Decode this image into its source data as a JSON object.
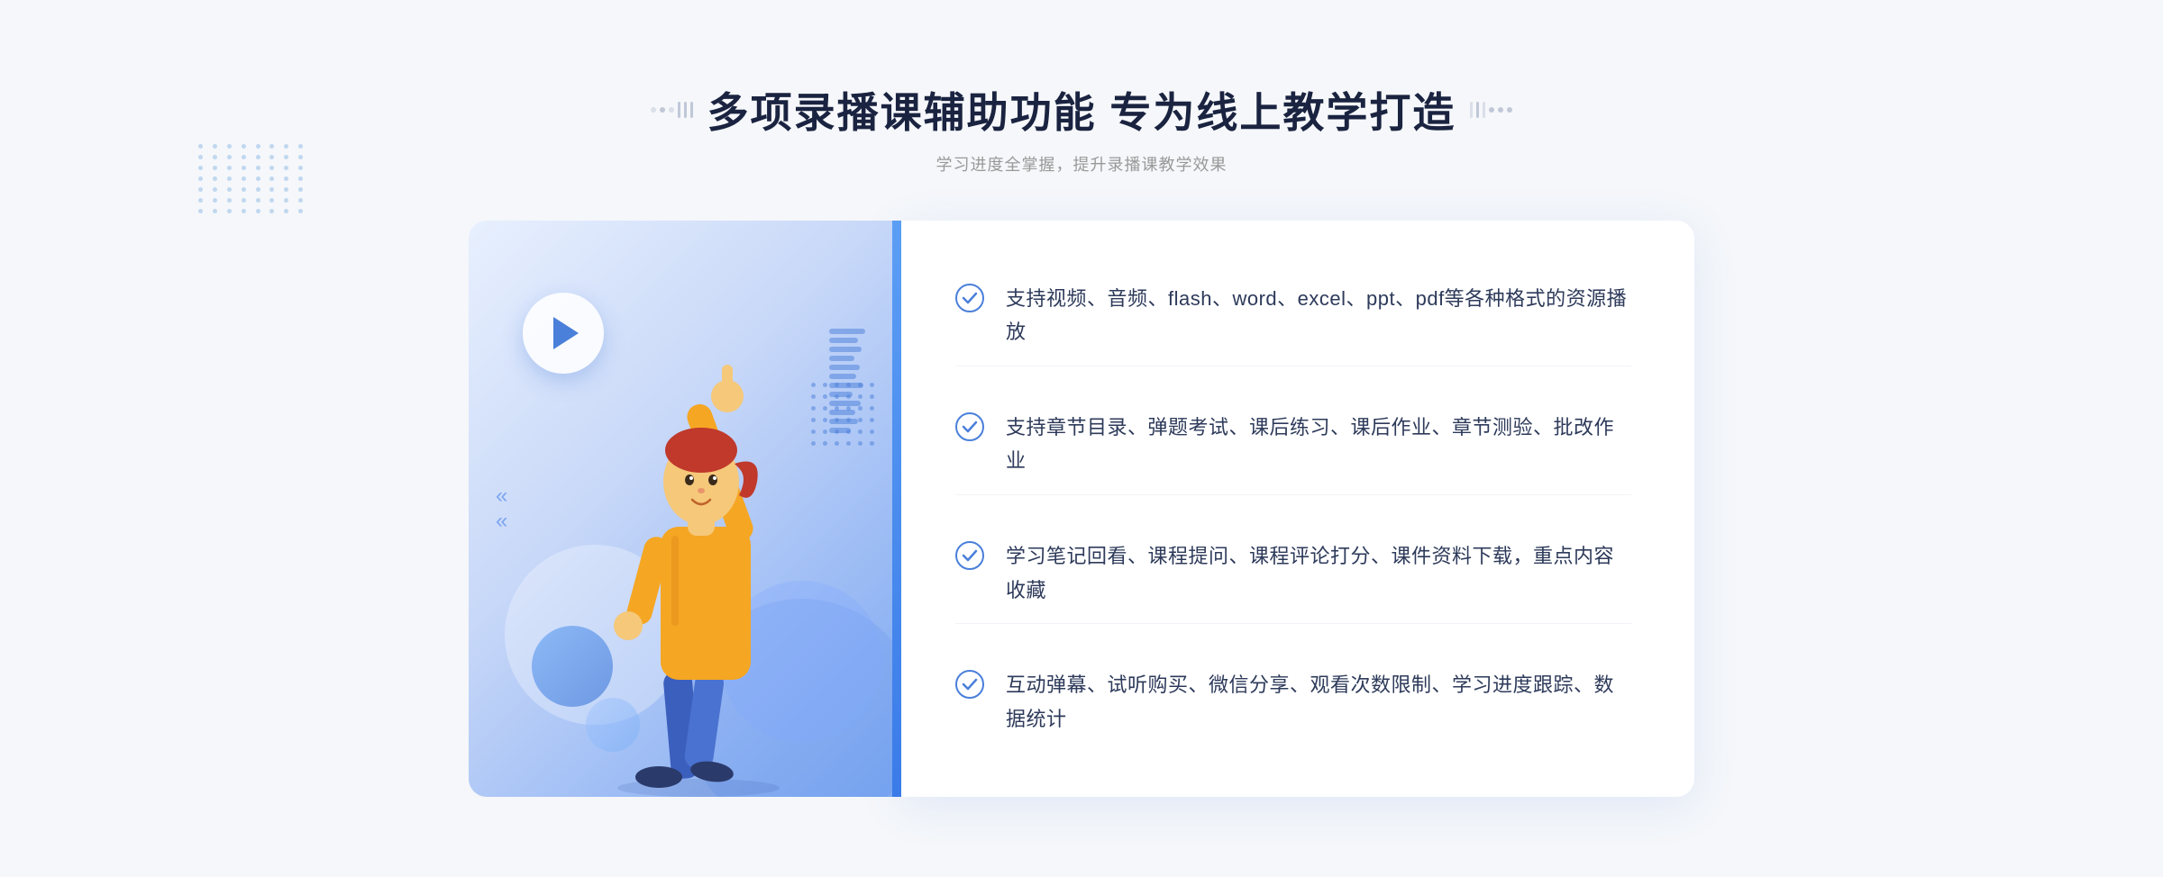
{
  "header": {
    "title": "多项录播课辅助功能 专为线上教学打造",
    "subtitle": "学习进度全掌握，提升录播课教学效果"
  },
  "features": [
    {
      "id": "feature-1",
      "text": "支持视频、音频、flash、word、excel、ppt、pdf等各种格式的资源播放"
    },
    {
      "id": "feature-2",
      "text": "支持章节目录、弹题考试、课后练习、课后作业、章节测验、批改作业"
    },
    {
      "id": "feature-3",
      "text": "学习笔记回看、课程提问、课程评论打分、课件资料下载，重点内容收藏"
    },
    {
      "id": "feature-4",
      "text": "互动弹幕、试听购买、微信分享、观看次数限制、学习进度跟踪、数据统计"
    }
  ],
  "decorators": {
    "title_dot_label": ":::",
    "chevron_label": "»"
  }
}
